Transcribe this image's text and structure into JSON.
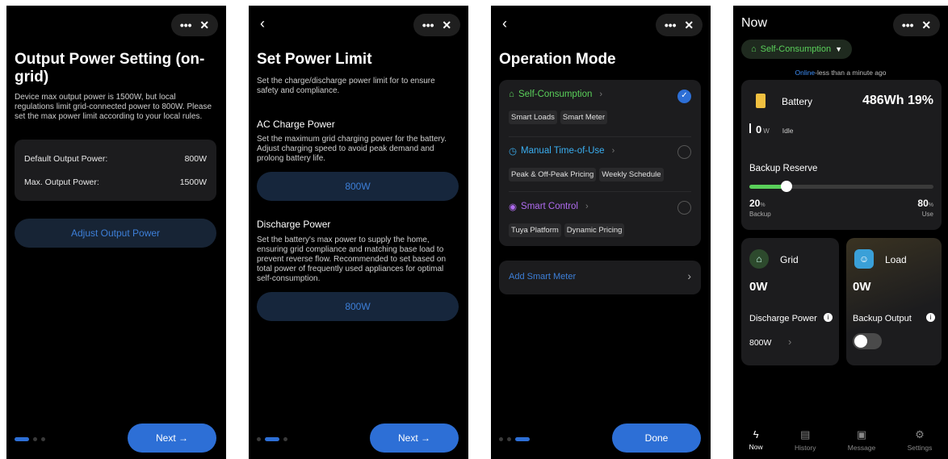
{
  "screen1": {
    "title": "Output Power Setting (on-grid)",
    "description": "Device max output power is 1500W, but local regulations limit grid-connected power to 800W. Please set the max power limit according to your local rules.",
    "rows": [
      {
        "label": "Default Output Power:",
        "value": "800W"
      },
      {
        "label": "Max. Output Power:",
        "value": "1500W"
      }
    ],
    "adjust_label": "Adjust Output Power",
    "next_label": "Next →"
  },
  "screen2": {
    "title": "Set Power Limit",
    "description": "Set the charge/discharge power limit for to ensure safety and compliance.",
    "ac_title": "AC Charge Power",
    "ac_desc": "Set the maximum grid charging power for the battery. Adjust charging speed to avoid peak demand and prolong battery life.",
    "ac_value": "800W",
    "dis_title": "Discharge Power",
    "dis_desc": "Set the battery's max power to supply the home, ensuring grid compliance and matching base load to prevent reverse flow. Recommended to set based on total power of frequently used appliances for optimal self-consumption.",
    "dis_value": "800W",
    "next_label": "Next →"
  },
  "screen3": {
    "title": "Operation Mode",
    "modes": [
      {
        "name": "Self-Consumption",
        "tags": [
          "Smart Loads",
          "Smart Meter"
        ],
        "color": "#5ad05a"
      },
      {
        "name": "Manual Time-of-Use",
        "tags": [
          "Peak & Off-Peak Pricing",
          "Weekly Schedule"
        ],
        "color": "#3aaef0"
      },
      {
        "name": "Smart Control",
        "tags": [
          "Tuya Platform",
          "Dynamic Pricing"
        ],
        "color": "#b06cf0"
      }
    ],
    "add_meter": "Add Smart Meter",
    "done_label": "Done"
  },
  "screen4": {
    "header": "Now",
    "mode_selector": "Self-Consumption",
    "online_status": "Online",
    "online_suffix": "-less than a minute ago",
    "battery": {
      "label": "Battery",
      "capacity": "486Wh 19%",
      "power_value": "0",
      "power_unit": "W",
      "state": "Idle"
    },
    "backup": {
      "label": "Backup Reserve",
      "backup_value": "20",
      "backup_unit": "%",
      "backup_label": "Backup",
      "use_value": "80",
      "use_unit": "%",
      "use_label": "Use",
      "reserve_fraction": 0.2
    },
    "grid": {
      "label": "Grid",
      "value": "0W",
      "discharge_label": "Discharge Power",
      "discharge_value": "800W"
    },
    "load": {
      "label": "Load",
      "value": "0W",
      "backup_output_label": "Backup Output"
    },
    "nav": [
      "Now",
      "History",
      "Message",
      "Settings"
    ]
  },
  "common": {
    "more": "•••",
    "close": "✕",
    "back": "‹"
  }
}
